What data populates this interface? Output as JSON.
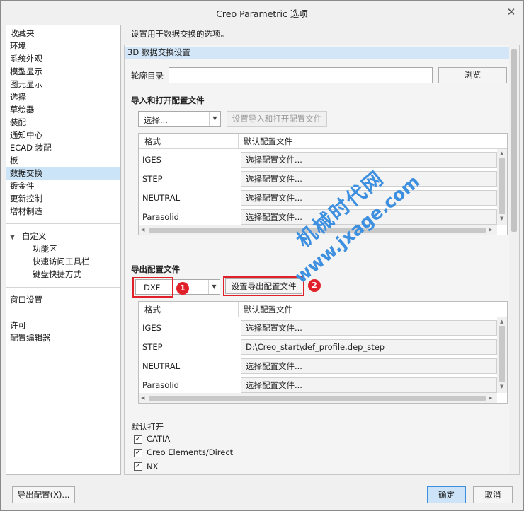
{
  "window": {
    "title": "Creo Parametric 选项",
    "close_icon": "close-icon"
  },
  "sidebar": {
    "items": [
      {
        "label": "收藏夹"
      },
      {
        "label": "环境"
      },
      {
        "label": "系统外观"
      },
      {
        "label": "模型显示"
      },
      {
        "label": "图元显示"
      },
      {
        "label": "选择"
      },
      {
        "label": "草绘器"
      },
      {
        "label": "装配"
      },
      {
        "label": "通知中心"
      },
      {
        "label": "ECAD 装配"
      },
      {
        "label": "板"
      },
      {
        "label": "数据交换",
        "selected": true
      },
      {
        "label": "钣金件"
      },
      {
        "label": "更新控制"
      },
      {
        "label": "增材制造"
      }
    ],
    "customize": {
      "label": "自定义",
      "expand_icon": "triangle-down-icon",
      "children": [
        {
          "label": "功能区"
        },
        {
          "label": "快速访问工具栏"
        },
        {
          "label": "键盘快捷方式"
        }
      ]
    },
    "window_settings": "窗口设置",
    "license": "许可",
    "config_editor": "配置编辑器"
  },
  "main": {
    "hint": "设置用于数据交换的选项。",
    "section_title": "3D 数据交换设置",
    "profile_dir": {
      "label": "轮廓目录",
      "value": "",
      "browse": "浏览"
    },
    "import": {
      "title": "导入和打开配置文件",
      "combo_value": "选择...",
      "set_button": "设置导入和打开配置文件",
      "headers": [
        "格式",
        "默认配置文件"
      ],
      "rows": [
        {
          "format": "IGES",
          "file": "选择配置文件..."
        },
        {
          "format": "STEP",
          "file": "选择配置文件..."
        },
        {
          "format": "NEUTRAL",
          "file": "选择配置文件..."
        },
        {
          "format": "Parasolid",
          "file": "选择配置文件..."
        }
      ]
    },
    "export": {
      "title": "导出配置文件",
      "combo_value": "DXF",
      "set_button": "设置导出配置文件",
      "badge1": "1",
      "badge2": "2",
      "headers": [
        "格式",
        "默认配置文件"
      ],
      "rows": [
        {
          "format": "IGES",
          "file": "选择配置文件..."
        },
        {
          "format": "STEP",
          "file": "D:\\Creo_start\\def_profile.dep_step"
        },
        {
          "format": "NEUTRAL",
          "file": "选择配置文件..."
        },
        {
          "format": "Parasolid",
          "file": "选择配置文件..."
        }
      ]
    },
    "default_open": {
      "title": "默认打开",
      "options": [
        {
          "label": "CATIA",
          "checked": true
        },
        {
          "label": "Creo Elements/Direct",
          "checked": true
        },
        {
          "label": "NX",
          "checked": true
        }
      ]
    }
  },
  "watermark": {
    "line1": "机械时代网",
    "line2": "www.jxage.com",
    "color": "#3d8fe0"
  },
  "footer": {
    "export_config": "导出配置(X)...",
    "ok": "确定",
    "cancel": "取消"
  },
  "colors": {
    "accent": "#cce4f7",
    "highlight_red": "#e0212a",
    "primary_button": "#cde4f8"
  }
}
